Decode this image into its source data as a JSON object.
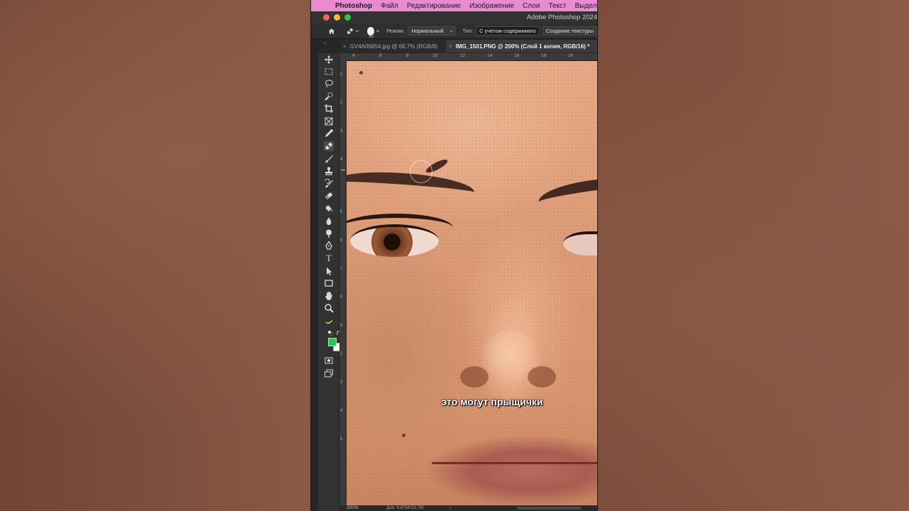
{
  "menubar": {
    "app_name": "Photoshop",
    "items": [
      "Файл",
      "Редактирование",
      "Изображение",
      "Слои",
      "Текст",
      "Выделение"
    ]
  },
  "window": {
    "title": "Adobe Photoshop 2024"
  },
  "options": {
    "brush_size": "50",
    "mode_label": "Режим:",
    "mode_value": "Нормальный",
    "type_label": "Тип:",
    "type_active": "С учетом содержимого",
    "type_other": "Создание текстуры"
  },
  "tabs": [
    {
      "label": "GV4A06854.jpg @ 66,7% (RGB/8)",
      "active": false
    },
    {
      "label": "IMG_1501.PNG @ 200% (Слой 1 копия, RGB/16) *",
      "active": true
    }
  ],
  "rulers": {
    "top": [
      "4",
      "6",
      "8",
      "10",
      "12",
      "14",
      "16",
      "18",
      "20"
    ],
    "left": [
      "1",
      "2",
      "3",
      "4",
      "5",
      "6",
      "7",
      "8",
      "9",
      "2",
      "3",
      "4",
      "5"
    ]
  },
  "canvas": {
    "subtitle": "это могут прыщички"
  },
  "status": {
    "zoom": "200%",
    "doc": "Док: 6,87M/13,7M",
    "arrow": "›"
  },
  "colors": {
    "foreground": "#19d03c",
    "background": "#ffffff",
    "menubar": "#e98bd0"
  },
  "tool_icons": [
    "move-icon",
    "marquee-icon",
    "lasso-icon",
    "quick-select-icon",
    "crop-icon",
    "frame-icon",
    "eyedropper-icon",
    "spot-healing-icon",
    "brush-icon",
    "clone-stamp-icon",
    "history-brush-icon",
    "eraser-icon",
    "paint-bucket-icon",
    "blur-icon",
    "dodge-icon",
    "pen-icon",
    "type-icon",
    "path-select-icon",
    "rectangle-icon",
    "hand-icon",
    "zoom-icon",
    "banana-icon",
    "quick-mask-icon",
    "screen-mode-icon"
  ]
}
